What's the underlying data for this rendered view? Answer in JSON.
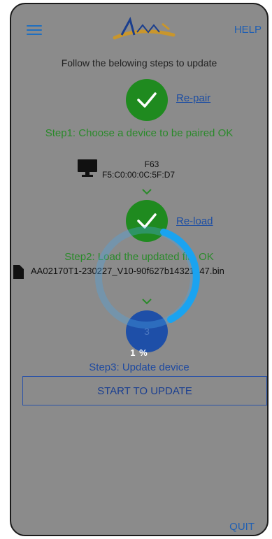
{
  "header": {
    "help_label": "HELP",
    "menu_icon": "hamburger-menu-icon",
    "logo_icon": "brand-logo"
  },
  "instruction": "Follow the belowing steps to update",
  "step1": {
    "link_label": "Re-pair",
    "status": "Step1: Choose a device to be paired OK",
    "device_name": "F63",
    "device_address": "F5:C0:00:0C:5F:D7",
    "device_icon": "monitor-icon"
  },
  "step2": {
    "link_label": "Re-load",
    "status": "Step2: Load the updated file OK",
    "file_name": "AA02170T1-230227_V10-90f627b14321b47.bin",
    "file_icon": "file-icon"
  },
  "step3": {
    "number": "3",
    "progress_text": "1 %",
    "progress_fraction": 0.01,
    "status": "Step3: Update device"
  },
  "start_button_label": "START TO UPDATE",
  "quit_label": "QUIT",
  "colors": {
    "overlay": "#8b8b8b",
    "ok_green": "#1f8a1f",
    "step_blue": "#1e4fa8",
    "spinner": "#1aa3f0",
    "link_blue": "#1d4ea3"
  }
}
